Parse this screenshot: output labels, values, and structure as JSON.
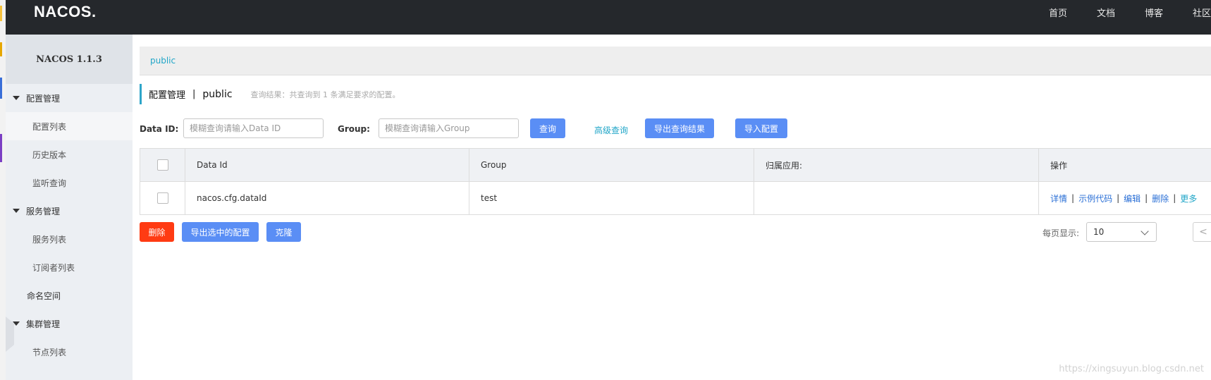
{
  "header": {
    "logo": "NACOS.",
    "nav": [
      "首页",
      "文档",
      "博客",
      "社区"
    ]
  },
  "sidebar": {
    "title": "NACOS 1.1.3",
    "config_group": "配置管理",
    "config_list": "配置列表",
    "history": "历史版本",
    "listener_query": "监听查询",
    "service_group": "服务管理",
    "service_list": "服务列表",
    "subscriber_list": "订阅者列表",
    "namespace": "命名空间",
    "cluster_group": "集群管理",
    "node_list": "节点列表"
  },
  "breadcrumb": {
    "namespace": "public"
  },
  "title": {
    "main": "配置管理",
    "separator": "|",
    "namespace": "public",
    "result": "查询结果：共查询到 1 条满足要求的配置。"
  },
  "search": {
    "dataid_label": "Data ID:",
    "dataid_placeholder": "模糊查询请输入Data ID",
    "group_label": "Group:",
    "group_placeholder": "模糊查询请输入Group",
    "query_button": "查询",
    "advanced_query": "高级查询",
    "export_results_button": "导出查询结果",
    "import_button": "导入配置"
  },
  "table": {
    "headers": [
      "Data Id",
      "Group",
      "归属应用:",
      "操作"
    ],
    "rows": [
      {
        "data_id": "nacos.cfg.dataId",
        "group": "test",
        "app": ""
      }
    ],
    "ops": {
      "detail": "详情",
      "sample_code": "示例代码",
      "edit": "编辑",
      "delete": "删除",
      "more": "更多",
      "sep": "|"
    }
  },
  "bottom": {
    "delete_button": "删除",
    "export_selected_button": "导出选中的配置",
    "clone_button": "克隆",
    "per_page_label": "每页显示:",
    "per_page_value": "10",
    "prev_glyph": "<"
  },
  "watermark": "https://xingsuyun.blog.csdn.net"
}
